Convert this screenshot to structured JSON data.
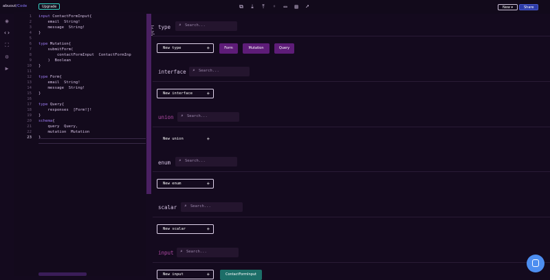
{
  "topbar": {
    "brand_left": "abuout",
    "brand_sep": "/",
    "brand_right": "Code",
    "upgrade_label": "Upgrade",
    "icons": [
      "copy-icon",
      "download-icon",
      "upload-icon",
      "bulb-icon",
      "book-icon",
      "save-icon",
      "rocket-icon"
    ],
    "new_label": "New ▾",
    "share_label": "Share"
  },
  "rail": {
    "icons": [
      "eye-icon",
      "code-icon",
      "expand-icon",
      "settings-icon",
      "play-icon"
    ]
  },
  "editor": {
    "active_line": 23,
    "lines": [
      {
        "n": "1",
        "text": "input ContactFormInput{"
      },
      {
        "n": "2",
        "text": "    email  String!"
      },
      {
        "n": "3",
        "text": "    message  String!"
      },
      {
        "n": "4",
        "text": "}"
      },
      {
        "n": "5",
        "text": ""
      },
      {
        "n": "6",
        "text": "type Mutation{"
      },
      {
        "n": "7",
        "text": "    submitForm("
      },
      {
        "n": "8",
        "text": "        contactFormInput  ContactFormInp"
      },
      {
        "n": "9",
        "text": "    )  Boolean"
      },
      {
        "n": "10",
        "text": "}"
      },
      {
        "n": "11",
        "text": ""
      },
      {
        "n": "12",
        "text": "type Form{"
      },
      {
        "n": "13",
        "text": "    email  String!"
      },
      {
        "n": "14",
        "text": "    message  String!"
      },
      {
        "n": "15",
        "text": "}"
      },
      {
        "n": "16",
        "text": ""
      },
      {
        "n": "17",
        "text": "type Query{"
      },
      {
        "n": "18",
        "text": "    responses  [Form!]!"
      },
      {
        "n": "19",
        "text": "}"
      },
      {
        "n": "20",
        "text": "schema{"
      },
      {
        "n": "21",
        "text": "    query  Query,"
      },
      {
        "n": "22",
        "text": "    mutation  Mutation"
      },
      {
        "n": "23",
        "text": "}"
      }
    ]
  },
  "sections": {
    "type": {
      "title": "type",
      "search_placeholder": "Search...",
      "new_label": "New type",
      "chips": [
        "Form",
        "Mutation",
        "Query"
      ]
    },
    "interface": {
      "title": "interface",
      "search_placeholder": "Search...",
      "new_label": "New interface"
    },
    "union": {
      "title": "union",
      "search_placeholder": "Search...",
      "new_label": "New union"
    },
    "enum": {
      "title": "enum",
      "search_placeholder": "Search...",
      "new_label": "New enum"
    },
    "scalar": {
      "title": "scalar",
      "search_placeholder": "Search...",
      "new_label": "New scalar"
    },
    "input": {
      "title": "input",
      "search_placeholder": "Search...",
      "new_label": "New input",
      "chips": [
        "ContactFormInput"
      ]
    }
  },
  "icons": {
    "search": "search-icon",
    "plus": "plus-icon",
    "chat": "chat-icon"
  },
  "colors": {
    "accent": "#8c78ff",
    "chip_purple": "#5e1c78",
    "chip_teal": "#1c6e68",
    "share": "#2c3aa8",
    "chat": "#4d8ef0"
  }
}
